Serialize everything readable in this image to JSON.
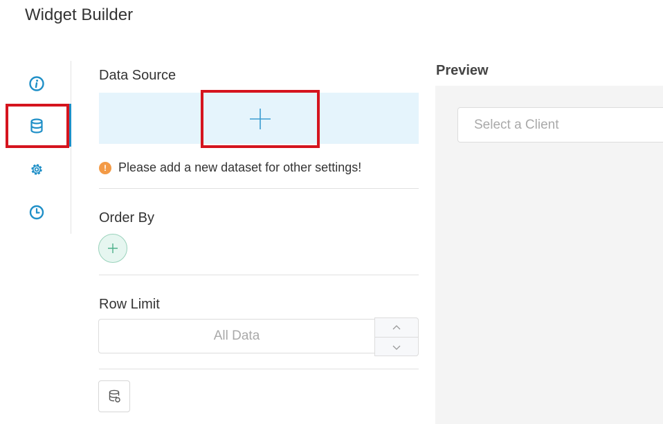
{
  "page": {
    "title": "Widget Builder"
  },
  "sidebar": {
    "items": [
      {
        "name": "info",
        "icon": "info-icon"
      },
      {
        "name": "data-source",
        "icon": "database-icon",
        "active": true
      },
      {
        "name": "settings",
        "icon": "gear-icon"
      },
      {
        "name": "schedule",
        "icon": "clock-icon"
      }
    ]
  },
  "data_source": {
    "label": "Data Source",
    "add_icon": "plus-icon",
    "hint_icon": "warning-dot-icon",
    "hint_icon_text": "!",
    "hint": "Please add a new dataset for other settings!"
  },
  "order_by": {
    "label": "Order By",
    "add_icon": "plus-icon"
  },
  "row_limit": {
    "label": "Row Limit",
    "placeholder": "All Data",
    "increment_icon": "chevron-up-icon",
    "decrement_icon": "chevron-down-icon"
  },
  "dataset_tool": {
    "icon": "database-settings-icon"
  },
  "preview": {
    "title": "Preview",
    "client_select_placeholder": "Select a Client"
  },
  "colors": {
    "accent": "#1f8fc7",
    "highlight_box": "#d5141e",
    "data_source_bg": "#e5f4fc",
    "hint_dot": "#f39a46",
    "order_add_bg": "#e6f6f0",
    "preview_bg": "#f4f4f4"
  }
}
